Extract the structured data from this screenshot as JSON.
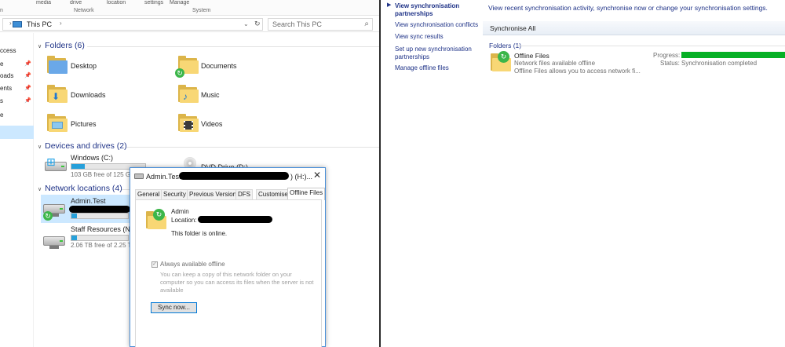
{
  "explorer": {
    "ribbon": {
      "small_labels": [
        "media",
        "drive",
        "location",
        "settings",
        "Manage"
      ],
      "groups": [
        "n",
        "Network",
        "System"
      ]
    },
    "address": {
      "path": "This PC",
      "search_placeholder": "Search This PC"
    },
    "sidebar": {
      "items": [
        "ccess",
        "e",
        "oads",
        "ents",
        "s",
        "e"
      ]
    },
    "groups": {
      "folders": "Folders (6)",
      "devices": "Devices and drives (2)",
      "network": "Network locations (4)"
    },
    "folders": [
      "Desktop",
      "Documents",
      "Downloads",
      "Music",
      "Pictures",
      "Videos"
    ],
    "drives": {
      "windows": {
        "name": "Windows (C:)",
        "free": "103 GB free of 125 GB",
        "used_fraction": 0.18
      },
      "dvd": {
        "name": "DVD Drive (D:)"
      }
    },
    "network_locations": {
      "admin": {
        "name": "Admin.Test",
        "used_fraction": 0.1
      },
      "staff": {
        "name": "Staff Resources (N:)",
        "free": "2.06 TB free of 2.25 TB",
        "used_fraction": 0.1
      }
    }
  },
  "dialog": {
    "title": "Admin.Test",
    "title_suffix": ") (H:)...",
    "tabs": [
      "General",
      "Security",
      "Previous Versions",
      "DFS",
      "Customise",
      "Offline Files"
    ],
    "active_tab": "Offline Files",
    "folder_name": "Admin",
    "location_label": "Location:",
    "status": "This folder is online.",
    "checkbox_label": "Always available offline",
    "description": "You can keep a copy of this network folder on your computer so you can access its files when the server is not available",
    "sync_button": "Sync now..."
  },
  "sync_center": {
    "tasks": [
      "View synchronisation partnerships",
      "View synchronisation conflicts",
      "View sync results",
      "Set up new synchronisation partnerships",
      "Manage offline files"
    ],
    "description": "View recent synchronisation activity, synchronise now or change your synchronisation settings.",
    "toolbar": {
      "sync_all": "Synchronise All"
    },
    "folders_header": "Folders (1)",
    "item": {
      "name": "Offline Files",
      "status": "Network files available offline",
      "description": "Offline Files allows you to access network fi...",
      "progress_label": "Progress:",
      "progress_fraction": 1.0,
      "status_label": "Status:",
      "status_value": "Synchronisation completed"
    }
  },
  "colors": {
    "link_blue": "#1e3287",
    "selection": "#cce8ff",
    "drive_fill": "#26a0da",
    "progress_green": "#06b025",
    "folder_yellow": "#f8d775"
  }
}
